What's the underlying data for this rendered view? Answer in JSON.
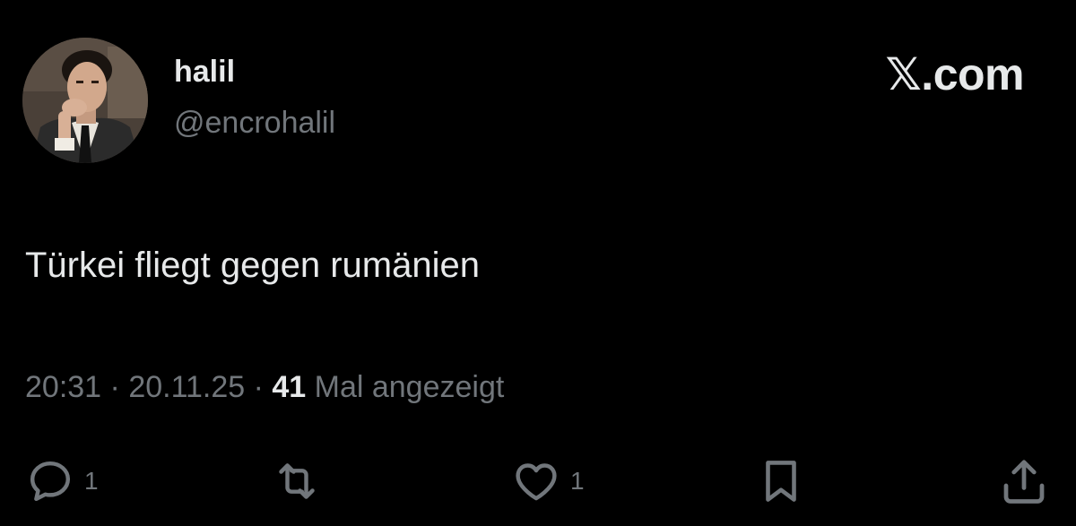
{
  "user": {
    "display_name": "halil",
    "handle": "@encrohalil"
  },
  "brand": {
    "label": "𝕏.com"
  },
  "tweet": {
    "text": "Türkei fliegt gegen rumänien"
  },
  "meta": {
    "time": "20:31",
    "separator": " · ",
    "date": "20.11.25",
    "views_count": "41",
    "views_label": " Mal angezeigt"
  },
  "actions": {
    "reply_count": "1",
    "like_count": "1"
  },
  "colors": {
    "background": "#000000",
    "primary_text": "#e7e9ea",
    "secondary_text": "#71767b"
  },
  "icons": [
    "reply-icon",
    "retweet-icon",
    "like-icon",
    "bookmark-icon",
    "share-icon"
  ]
}
